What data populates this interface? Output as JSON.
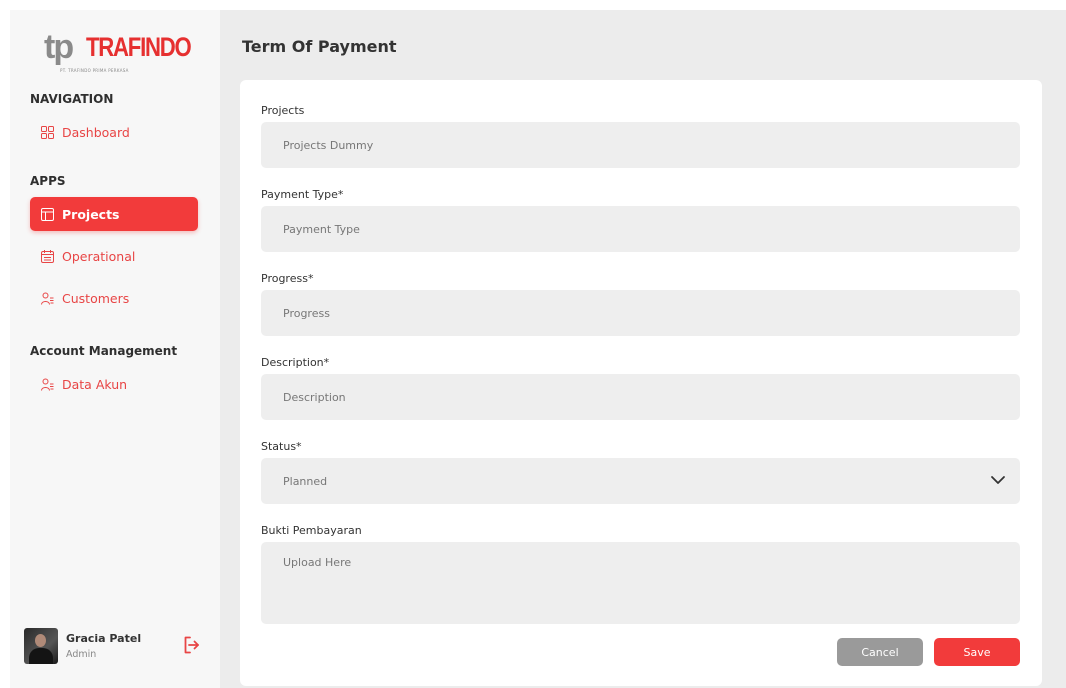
{
  "brand": {
    "logo_mark": "tp",
    "logo_text": "TRAFINDO",
    "logo_subtitle": "PT. TRAFINDO PRIMA PERKASA"
  },
  "sidebar": {
    "navigation_title": "NAVIGATION",
    "apps_title": "APPS",
    "account_title": "Account Management",
    "items": [
      {
        "label": "Dashboard",
        "icon": "grid-icon"
      },
      {
        "label": "Projects",
        "icon": "window-icon",
        "active": true
      },
      {
        "label": "Operational",
        "icon": "calendar-icon"
      },
      {
        "label": "Customers",
        "icon": "users-icon"
      },
      {
        "label": "Data Akun",
        "icon": "users-icon"
      }
    ]
  },
  "user": {
    "name": "Gracia Patel",
    "role": "Admin"
  },
  "page": {
    "title": "Term Of Payment"
  },
  "form": {
    "projects": {
      "label": "Projects",
      "value": "Projects Dummy"
    },
    "payment_type": {
      "label": "Payment Type*",
      "placeholder": "Payment Type"
    },
    "progress": {
      "label": "Progress*",
      "placeholder": "Progress"
    },
    "description": {
      "label": "Description*",
      "placeholder": "Description"
    },
    "status": {
      "label": "Status*",
      "value": "Planned"
    },
    "bukti": {
      "label": "Bukti Pembayaran",
      "placeholder": "Upload Here"
    },
    "cancel_label": "Cancel",
    "save_label": "Save"
  },
  "colors": {
    "accent": "#f23b3b",
    "cancel": "#9a9a9a",
    "input_bg": "#eeeeee",
    "sidebar_bg": "#f7f7f7",
    "main_bg": "#ececec"
  }
}
